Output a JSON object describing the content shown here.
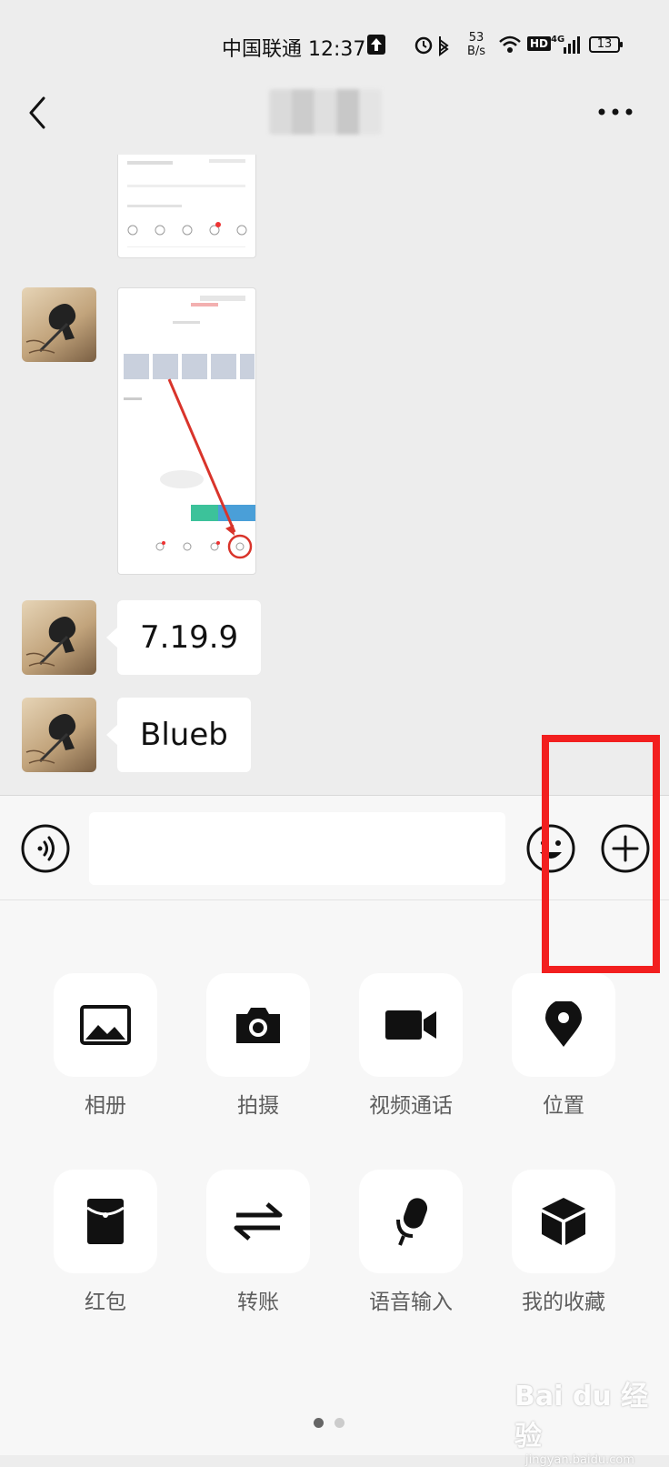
{
  "status_bar": {
    "carrier_time": "中国联通 12:37",
    "net_speed_value": "53",
    "net_speed_unit": "B/s",
    "network_label": "HD",
    "signal_label": "4G",
    "battery_level": "13"
  },
  "header": {
    "title": "",
    "back_icon": "back-chevron-icon",
    "more_icon": "more-dots-icon"
  },
  "messages": [
    {
      "type": "image",
      "content": "screenshot-thumbnail"
    },
    {
      "type": "image",
      "content": "screenshot-with-arrow"
    },
    {
      "type": "text",
      "content": "7.19.9"
    },
    {
      "type": "text",
      "content": "Blueb"
    }
  ],
  "input_bar": {
    "value": "",
    "placeholder": ""
  },
  "panel": {
    "items": [
      {
        "label": "相册",
        "icon": "photo-album-icon"
      },
      {
        "label": "拍摄",
        "icon": "camera-icon"
      },
      {
        "label": "视频通话",
        "icon": "video-call-icon"
      },
      {
        "label": "位置",
        "icon": "location-icon"
      },
      {
        "label": "红包",
        "icon": "red-packet-icon"
      },
      {
        "label": "转账",
        "icon": "transfer-icon"
      },
      {
        "label": "语音输入",
        "icon": "voice-input-icon"
      },
      {
        "label": "我的收藏",
        "icon": "favorites-icon"
      }
    ],
    "page_count": 2,
    "current_page": 1
  },
  "annotation": {
    "highlight_color": "#f21f1f"
  },
  "watermark": {
    "brand": "Bai du 经验",
    "url": "jingyan.baidu.com"
  }
}
